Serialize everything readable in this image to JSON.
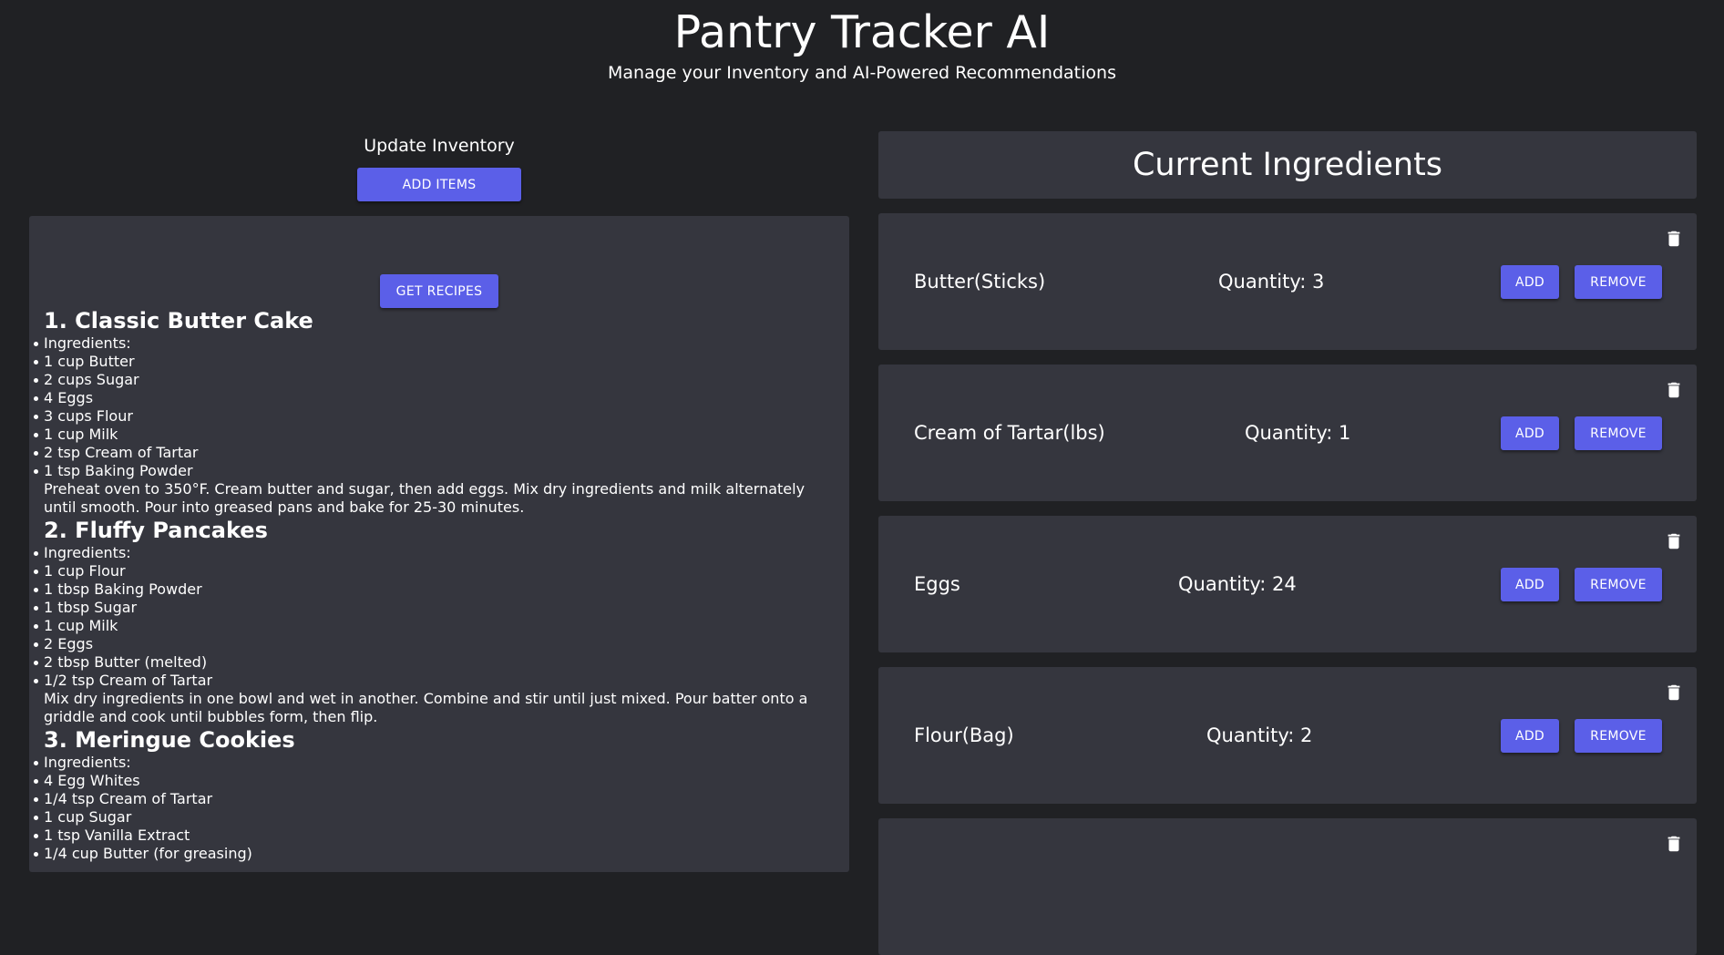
{
  "app": {
    "title": "Pantry Tracker AI",
    "subtitle": "Manage your Inventory and AI-Powered Recommendations"
  },
  "inventory": {
    "heading": "Update Inventory",
    "add_items_label": "ADD ITEMS"
  },
  "recipes_panel": {
    "get_recipes_label": "GET RECIPES",
    "recipes": [
      {
        "title": "1. Classic Butter Cake",
        "ingredients_label": "Ingredients:",
        "ingredients": [
          "1 cup Butter",
          "2 cups Sugar",
          "4 Eggs",
          "3 cups Flour",
          "1 cup Milk",
          "2 tsp Cream of Tartar",
          "1 tsp Baking Powder"
        ],
        "instructions": "Preheat oven to 350°F. Cream butter and sugar, then add eggs. Mix dry ingredients and milk alternately until smooth. Pour into greased pans and bake for 25-30 minutes."
      },
      {
        "title": "2. Fluffy Pancakes",
        "ingredients_label": "Ingredients:",
        "ingredients": [
          "1 cup Flour",
          "1 tbsp Baking Powder",
          "1 tbsp Sugar",
          "1 cup Milk",
          "2 Eggs",
          "2 tbsp Butter (melted)",
          "1/2 tsp Cream of Tartar"
        ],
        "instructions": "Mix dry ingredients in one bowl and wet in another. Combine and stir until just mixed. Pour batter onto a griddle and cook until bubbles form, then flip."
      },
      {
        "title": "3. Meringue Cookies",
        "ingredients_label": "Ingredients:",
        "ingredients": [
          "4 Egg Whites",
          "1/4 tsp Cream of Tartar",
          "1 cup Sugar",
          "1 tsp Vanilla Extract",
          "1/4 cup Butter (for greasing)"
        ],
        "instructions": ""
      }
    ]
  },
  "ingredients_panel": {
    "title": "Current Ingredients",
    "add_label": "ADD",
    "remove_label": "REMOVE",
    "items": [
      {
        "name": "Butter(Sticks)",
        "quantity_text": "Quantity: 3"
      },
      {
        "name": "Cream of Tartar(lbs)",
        "quantity_text": "Quantity: 1"
      },
      {
        "name": "Eggs",
        "quantity_text": "Quantity: 24"
      },
      {
        "name": "Flour(Bag)",
        "quantity_text": "Quantity: 2"
      },
      {
        "name": "",
        "quantity_text": ""
      }
    ]
  },
  "icons": {
    "delete": "trash-icon"
  },
  "colors": {
    "background": "#202124",
    "panel": "#35363e",
    "accent": "#5b5fe8",
    "text": "#ffffff"
  }
}
